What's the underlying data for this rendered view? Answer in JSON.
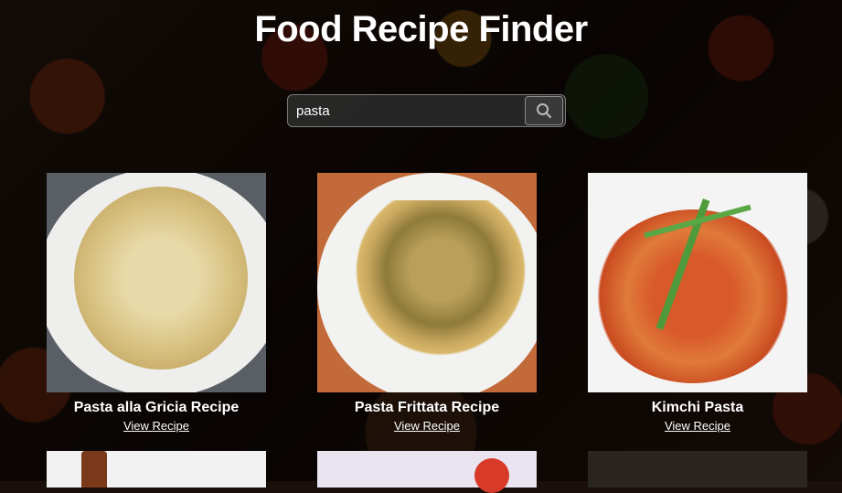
{
  "header": {
    "title": "Food Recipe Finder"
  },
  "search": {
    "value": "pasta",
    "icon": "search-icon"
  },
  "recipes": [
    {
      "name": "Pasta alla Gricia Recipe",
      "link": "View Recipe"
    },
    {
      "name": "Pasta Frittata Recipe",
      "link": "View Recipe"
    },
    {
      "name": "Kimchi Pasta",
      "link": "View Recipe"
    }
  ]
}
